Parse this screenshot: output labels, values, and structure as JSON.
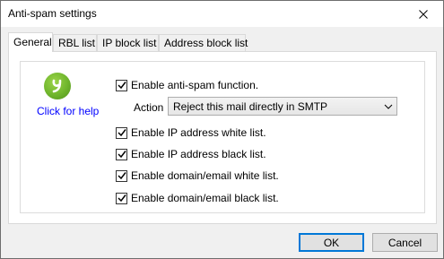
{
  "window": {
    "title": "Anti-spam settings"
  },
  "tabs": [
    {
      "label": "General",
      "active": true
    },
    {
      "label": "RBL list",
      "active": false
    },
    {
      "label": "IP block list",
      "active": false
    },
    {
      "label": "Address block list",
      "active": false
    }
  ],
  "help": {
    "label": "Click for help",
    "icon": "app-logo-icon"
  },
  "enable_antispam": {
    "label": "Enable anti-spam function.",
    "checked": true
  },
  "action": {
    "label": "Action",
    "selected": "Reject this mail directly in SMTP"
  },
  "options": [
    {
      "label": "Enable IP address white list.",
      "checked": true
    },
    {
      "label": "Enable IP address black list.",
      "checked": true
    },
    {
      "label": "Enable domain/email white list.",
      "checked": true
    },
    {
      "label": "Enable domain/email black list.",
      "checked": true
    }
  ],
  "buttons": {
    "ok": "OK",
    "cancel": "Cancel"
  },
  "colors": {
    "link": "#0000ff",
    "logo": "#6fb52c",
    "default_border": "#0078d7"
  }
}
